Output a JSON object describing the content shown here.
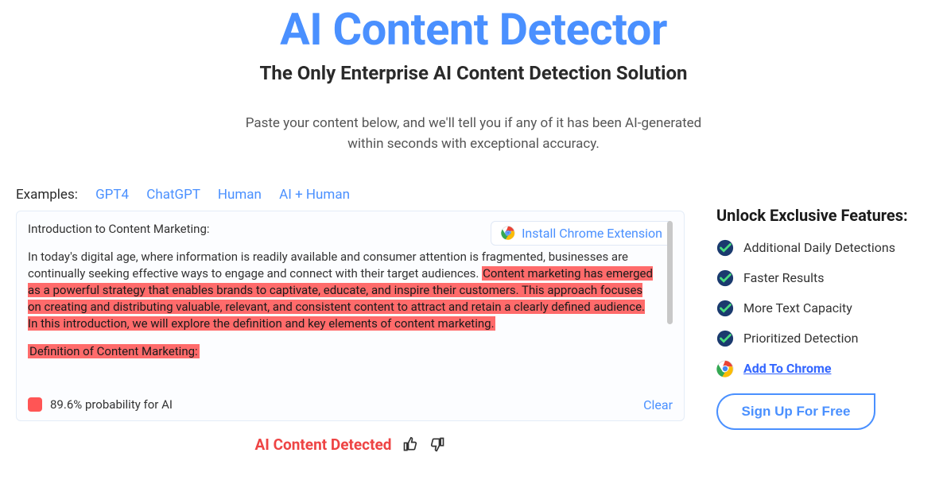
{
  "hero": {
    "title": "AI Content Detector",
    "subtitle": "The Only Enterprise AI Content Detection Solution",
    "desc_line1": "Paste your content below, and we'll tell you if any of it has been AI-generated",
    "desc_line2": "within seconds with exceptional accuracy."
  },
  "examples": {
    "label": "Examples:",
    "items": [
      "GPT4",
      "ChatGPT",
      "Human",
      "AI + Human"
    ]
  },
  "install_badge": "Install Chrome Extension",
  "content": {
    "heading": "Introduction to Content Marketing:",
    "para_pre": "In today's digital age, where information is readily available and consumer attention is fragmented, businesses are continually seeking effective ways to engage and connect with their target audiences. ",
    "para_hl": "Content marketing has emerged as a powerful strategy that enables brands to captivate, educate, and inspire their customers. This approach focuses on creating and distributing valuable, relevant, and consistent content to attract and retain a clearly defined audience. In this introduction, we will explore the definition and key elements of content marketing.",
    "sub_hl": "Definition of Content Marketing:"
  },
  "probability": "89.6% probability for AI",
  "clear": "Clear",
  "result": "AI Content Detected",
  "right": {
    "title": "Unlock Exclusive Features:",
    "features": [
      "Additional Daily Detections",
      "Faster Results",
      "More Text Capacity",
      "Prioritized Detection"
    ],
    "add_chrome": "Add To Chrome",
    "signup": "Sign Up For Free"
  }
}
